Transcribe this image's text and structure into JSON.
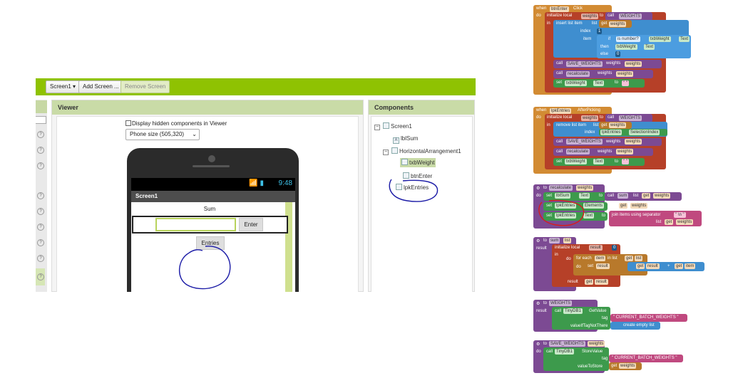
{
  "topbar": {
    "screen_select": "Screen1 ▾",
    "add_screen": "Add Screen ...",
    "remove_screen": "Remove Screen"
  },
  "viewer": {
    "title": "Viewer",
    "hidden_checkbox_label": "Display hidden components in Viewer",
    "phone_size": "Phone size (505,320)",
    "status_time": "9:48",
    "app_title": "Screen1",
    "label_sum": "Sum",
    "enter_button": "Enter",
    "entries_button": "Entries"
  },
  "components": {
    "title": "Components",
    "tree": [
      "Screen1",
      "lblSum",
      "HorizontalArrangement1",
      "txbWeight",
      "btnEnter",
      "lpkEntries"
    ]
  },
  "blocks": {
    "b1": {
      "when": "when",
      "comp": "btnEnter",
      "event": "Click",
      "do": "do",
      "init": "initialize local",
      "var": "weights",
      "to": "to",
      "call": "call",
      "proc": "WEIGHTS",
      "in": "in",
      "insert": "insert list item",
      "list": "list",
      "get": "get",
      "getvar": "weights",
      "index": "index",
      "idx": "1",
      "item": "item",
      "if": "if",
      "isnum": "is number?",
      "txb": "txbWeight",
      "text": "Text",
      "then": "then",
      "else": "else",
      "zero": "0",
      "save": "SAVE_WEIGHTS",
      "weights": "weights",
      "recalc": "recalculate",
      "set": "set",
      "empty": "\" \""
    },
    "b2": {
      "when": "when",
      "comp": "lpkEntries",
      "event": "AfterPicking",
      "do": "do",
      "init": "initialize local",
      "var": "weights",
      "to": "to",
      "call": "call",
      "proc": "WEIGHTS",
      "in": "in",
      "remove": "remove list item",
      "list": "list",
      "get": "get",
      "getvar": "weights",
      "index": "index",
      "lpk": "lpkEntries",
      "selidx": "SelectionIndex",
      "save": "SAVE_WEIGHTS",
      "weights": "weights",
      "recalc": "recalculate",
      "set": "set",
      "txb": "txbWeight",
      "text": "Text",
      "empty": "\" \""
    },
    "b3": {
      "to": "to",
      "name": "recalculate",
      "param": "weights",
      "do": "do",
      "set": "set",
      "lbl": "lblSum",
      "text": "Text",
      "call": "call",
      "sum": "sum",
      "list": "list",
      "get": "get",
      "getvar": "weights",
      "lpk": "lpkEntries",
      "elements": "Elements",
      "join": "join items using separator",
      "sep": "\" \\n \""
    },
    "b4": {
      "to": "to",
      "name": "sum",
      "param": "list",
      "result": "result",
      "init": "initialize local",
      "var": "result",
      "zero": "0",
      "in": "in",
      "do": "do",
      "foreach": "for each",
      "item": "item",
      "inlist": "in list",
      "get": "get",
      "list": "list",
      "set": "set",
      "plus": "+"
    },
    "b5": {
      "to": "to",
      "name": "WEIGHTS",
      "result": "result",
      "call": "call",
      "db": "TinyDB1",
      "getvalue": "GetValue",
      "tag": "tag",
      "tagval": "\" CURRENT_BATCH_WEIGHTS \"",
      "ifnot": "valueIfTagNotThere",
      "create": "create empty list"
    },
    "b6": {
      "to": "to",
      "name": "SAVE_WEIGHTS",
      "param": "weights",
      "do": "do",
      "call": "call",
      "db": "TinyDB1",
      "store": "StoreValue",
      "tag": "tag",
      "tagval": "\" CURRENT_BATCH_WEIGHTS \"",
      "valuetostore": "valueToStore",
      "get": "get",
      "getvar": "weights"
    }
  },
  "colors": {
    "topbar": "#8fc202",
    "panel_header": "#c9dba7",
    "procedure": "#7c4a93",
    "event": "#d28b33",
    "variable": "#b64028",
    "list": "#3f8ecf",
    "component": "#3d9a4c",
    "text": "#c0497f",
    "annotation": "#1a1aa6"
  }
}
